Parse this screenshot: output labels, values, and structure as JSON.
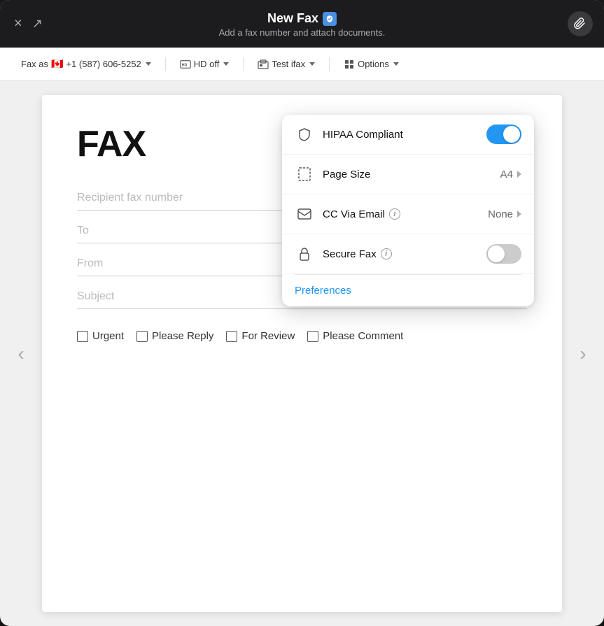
{
  "window": {
    "title": "New Fax",
    "subtitle": "Add a fax number and attach documents.",
    "shield_char": "🛡"
  },
  "toolbar": {
    "fax_as_label": "Fax as",
    "flag_emoji": "🇨🇦",
    "fax_number": "+1 (587) 606-5252",
    "hd_label": "HD off",
    "test_label": "Test ifax",
    "options_label": "Options"
  },
  "fax_form": {
    "fax_title": "FAX",
    "recipient_placeholder": "Recipient fax number",
    "to_placeholder": "To",
    "from_placeholder": "From",
    "subject_placeholder": "Subject",
    "checkboxes": [
      {
        "id": "urgent",
        "label": "Urgent"
      },
      {
        "id": "please-reply",
        "label": "Please Reply"
      },
      {
        "id": "for-review",
        "label": "For Review"
      },
      {
        "id": "please-comment",
        "label": "Please Comment"
      }
    ]
  },
  "dropdown": {
    "items": [
      {
        "id": "hipaa",
        "label": "HIPAA Compliant",
        "type": "toggle",
        "value": true,
        "icon": "shield"
      },
      {
        "id": "page-size",
        "label": "Page Size",
        "type": "chevron",
        "value": "A4",
        "icon": "page"
      },
      {
        "id": "cc-email",
        "label": "CC Via Email",
        "type": "chevron",
        "value": "None",
        "icon": "email",
        "has_info": true
      },
      {
        "id": "secure-fax",
        "label": "Secure Fax",
        "type": "toggle",
        "value": false,
        "icon": "lock",
        "has_info": true
      }
    ],
    "preferences_label": "Preferences"
  },
  "nav": {
    "left_arrow": "‹",
    "right_arrow": "›"
  },
  "buttons": {
    "close_label": "×",
    "resize_label": "↗",
    "attach_label": "📎"
  }
}
